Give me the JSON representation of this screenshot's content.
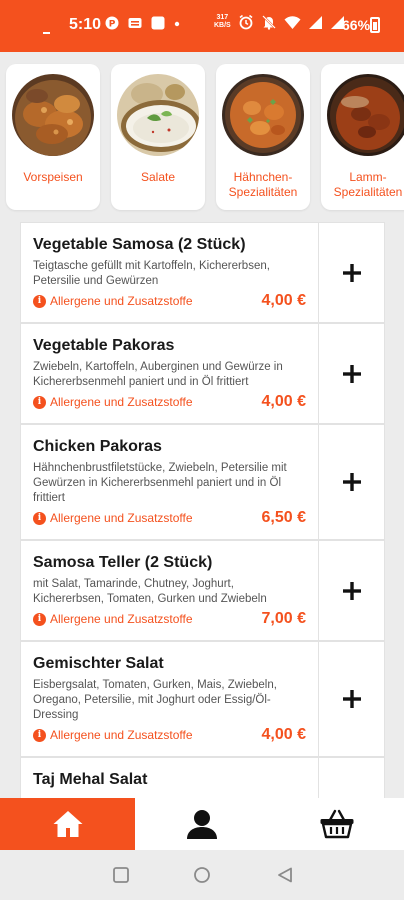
{
  "status_bar": {
    "time": "5:10",
    "net_speed_value": "317",
    "net_speed_unit": "KB/S",
    "battery": "66%"
  },
  "categories": [
    {
      "label": "Vorspeisen",
      "icon": "pakora-dish-image"
    },
    {
      "label": "Salate",
      "icon": "salad-bowl-image"
    },
    {
      "label": "Hähnchen-Spezialitäten",
      "icon": "chicken-curry-image"
    },
    {
      "label": "Lamm-Spezialitäten",
      "icon": "lamb-curry-image"
    }
  ],
  "menu": {
    "allergen_label": "Allergene und Zusatzstoffe",
    "add_icon": "plus-icon",
    "items": [
      {
        "name": "Vegetable Samosa (2 Stück)",
        "description": "Teigtasche gefüllt mit Kartoffeln, Kichererbsen, Petersilie und Gewürzen",
        "price": "4,00 €"
      },
      {
        "name": "Vegetable Pakoras",
        "description": "Zwiebeln, Kartoffeln, Auberginen und Gewürze in Kichererbsenmehl paniert und in Öl frittiert",
        "price": "4,00 €"
      },
      {
        "name": "Chicken Pakoras",
        "description": "Hähnchenbrustfiletstücke, Zwiebeln, Petersilie mit Gewürzen in Kichererbsenmehl paniert und in Öl frittiert",
        "price": "6,50 €"
      },
      {
        "name": "Samosa Teller (2 Stück)",
        "description": "mit Salat, Tamarinde, Chutney, Joghurt, Kichererbsen, Tomaten, Gurken und Zwiebeln",
        "price": "7,00 €"
      },
      {
        "name": "Gemischter Salat",
        "description": "Eisbergsalat, Tomaten, Gurken, Mais, Zwiebeln, Oregano, Petersilie, mit Joghurt oder Essig/Öl-Dressing",
        "price": "4,00 €"
      },
      {
        "name": "Taj Mehal Salat",
        "description": "",
        "price": ""
      }
    ]
  },
  "bottom_nav": {
    "tabs": [
      {
        "icon": "home-icon",
        "active": true
      },
      {
        "icon": "user-icon",
        "active": false
      },
      {
        "icon": "basket-icon",
        "active": false
      }
    ]
  },
  "theme": {
    "accent": "#f4511e",
    "background": "#ececec"
  }
}
